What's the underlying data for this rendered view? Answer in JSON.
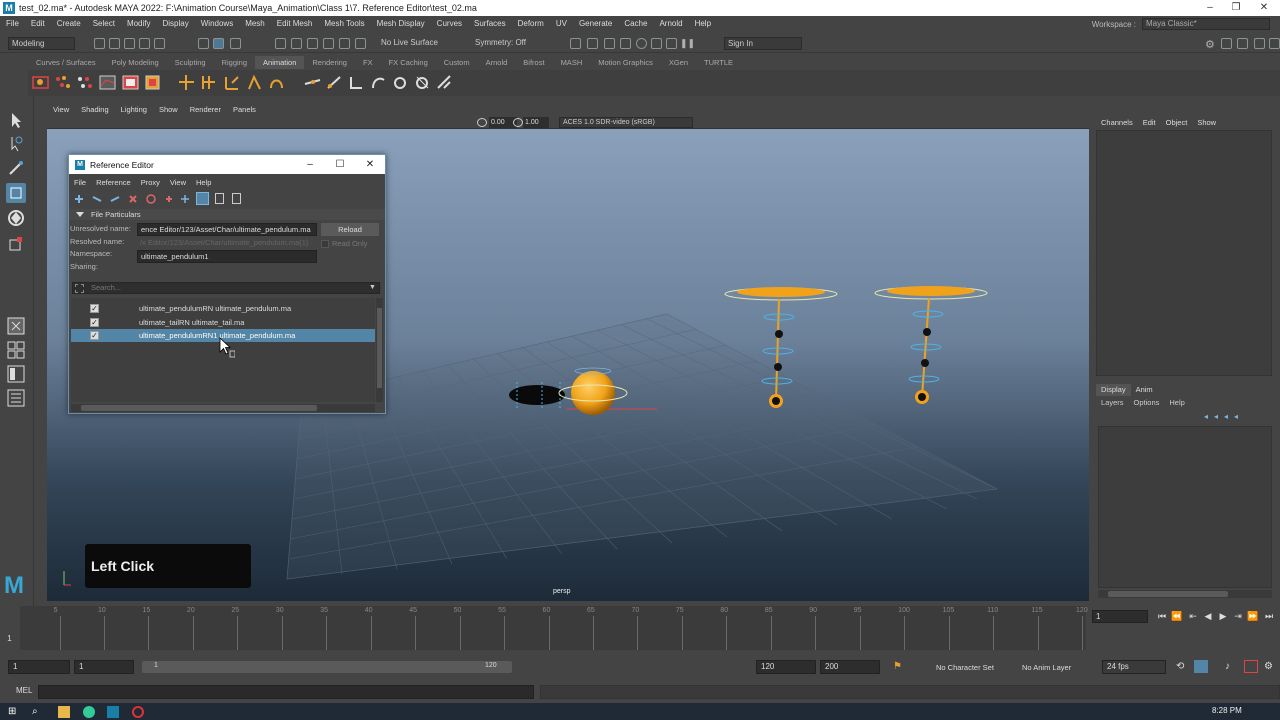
{
  "window": {
    "title": "test_02.ma* - Autodesk MAYA 2022: F:\\Animation Course\\Maya_Animation\\Class 1\\7. Reference Editor\\test_02.ma",
    "logo": "M"
  },
  "menubar": {
    "items": [
      "File",
      "Edit",
      "Create",
      "Select",
      "Modify",
      "Display",
      "Windows",
      "Mesh",
      "Edit Mesh",
      "Mesh Tools",
      "Mesh Display",
      "Curves",
      "Surfaces",
      "Deform",
      "UV",
      "Generate",
      "Cache",
      "Arnold",
      "Help"
    ],
    "workspace_label": "Workspace :",
    "workspace_value": "Maya Classic*"
  },
  "statusline": {
    "mode": "Modeling",
    "live_surface": "No Live Surface",
    "symmetry": "Symmetry: Off",
    "sign_in": "Sign In"
  },
  "shelf": {
    "tabs": [
      "Curves / Surfaces",
      "Poly Modeling",
      "Sculpting",
      "Rigging",
      "Animation",
      "Rendering",
      "FX",
      "FX Caching",
      "Custom",
      "Arnold",
      "Bifrost",
      "MASH",
      "Motion Graphics",
      "XGen",
      "TURTLE"
    ],
    "active_tab": "Animation"
  },
  "viewport": {
    "menu": [
      "View",
      "Shading",
      "Lighting",
      "Show",
      "Renderer",
      "Panels"
    ],
    "near_value": "0.00",
    "far_value": "1.00",
    "color_space": "ACES 1.0 SDR-video (sRGB)",
    "camera_label": "persp",
    "click_banner": "Left Click"
  },
  "channelbox": {
    "tabs": [
      "Channels",
      "Edit",
      "Object",
      "Show"
    ]
  },
  "layereditor": {
    "tabs": [
      "Display",
      "Anim"
    ],
    "active_tab": "Display",
    "menu": [
      "Layers",
      "Options",
      "Help"
    ]
  },
  "timeline": {
    "ticks": [
      5,
      10,
      15,
      20,
      25,
      30,
      35,
      40,
      45,
      50,
      55,
      60,
      65,
      70,
      75,
      80,
      85,
      90,
      95,
      100,
      105,
      110,
      115,
      120
    ],
    "current_frame_marker": "1",
    "current_frame": "1"
  },
  "range": {
    "start": "1",
    "playback_start": "1",
    "slider_start": "1",
    "slider_end": "120",
    "playback_end": "120",
    "end": "200",
    "character_set": "No Character Set",
    "anim_layer": "No Anim Layer",
    "fps": "24 fps"
  },
  "cmdline": {
    "label": "MEL"
  },
  "taskbar": {
    "time": "8:28 PM"
  },
  "reference_editor": {
    "title": "Reference Editor",
    "menu": [
      "File",
      "Reference",
      "Proxy",
      "View",
      "Help"
    ],
    "section": "File Particulars",
    "unresolved_label": "Unresolved name:",
    "unresolved_value": "ence Editor/123/Asset/Char/ultimate_pendulum.ma",
    "resolved_label": "Resolved name:",
    "resolved_value": "/x Editor/123/Asset/Char/ultimate_pendulum.ma{1}",
    "namespace_label": "Namespace:",
    "namespace_value": "ultimate_pendulum1",
    "sharing_label": "Sharing:",
    "reload_button": "Reload",
    "read_only": "Read Only",
    "search_placeholder": "Search...",
    "references": [
      {
        "label": "ultimate_pendulumRN ultimate_pendulum.ma",
        "checked": true,
        "selected": false
      },
      {
        "label": "ultimate_tailRN ultimate_tail.ma",
        "checked": true,
        "selected": false
      },
      {
        "label": "ultimate_pendulumRN1 ultimate_pendulum.ma",
        "checked": true,
        "selected": true
      }
    ]
  },
  "colors": {
    "accent": "#5285a6",
    "sphere": "#f0a31a",
    "selection_ring": "#e8e8b0"
  }
}
